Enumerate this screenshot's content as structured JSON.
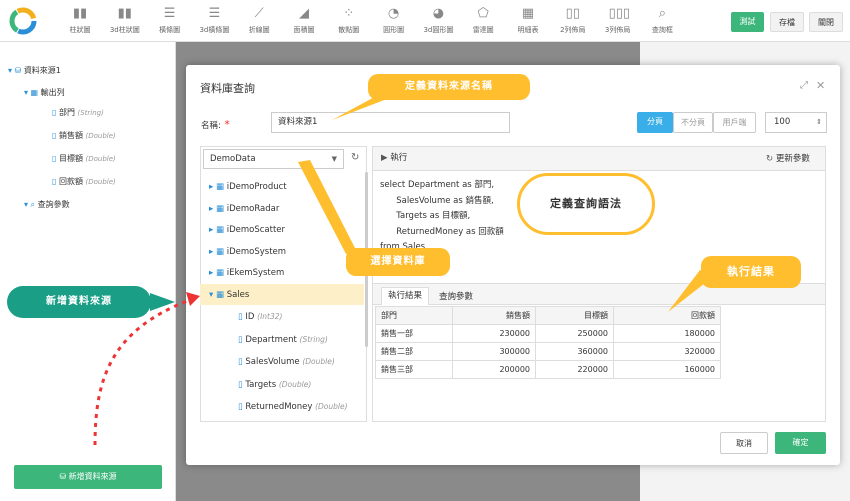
{
  "toolbar": {
    "tools": [
      {
        "label": "柱狀圖",
        "icon": "bar-chart-icon"
      },
      {
        "label": "3d柱狀圖",
        "icon": "3d-bar-chart-icon"
      },
      {
        "label": "橫條圖",
        "icon": "horizontal-bar-icon"
      },
      {
        "label": "3d橫條圖",
        "icon": "3d-horizontal-bar-icon"
      },
      {
        "label": "折線圖",
        "icon": "line-chart-icon"
      },
      {
        "label": "面積圖",
        "icon": "area-chart-icon"
      },
      {
        "label": "散點圖",
        "icon": "scatter-chart-icon"
      },
      {
        "label": "圓形圖",
        "icon": "pie-chart-icon"
      },
      {
        "label": "3d圓形圖",
        "icon": "3d-pie-chart-icon"
      },
      {
        "label": "雷達圖",
        "icon": "radar-chart-icon"
      },
      {
        "label": "明細表",
        "icon": "table-icon"
      },
      {
        "label": "2列佈局",
        "icon": "two-column-icon"
      },
      {
        "label": "3列佈局",
        "icon": "three-column-icon"
      },
      {
        "label": "查詢框",
        "icon": "search-icon"
      }
    ],
    "test_label": "測試",
    "save_label": "存檔",
    "close_label": "關閉",
    "accent": "#3cb67b"
  },
  "tree": {
    "datasource": "資料來源1",
    "output": "輸出列",
    "fields": [
      {
        "name": "部門",
        "type": "(String)"
      },
      {
        "name": "銷售額",
        "type": "(Double)"
      },
      {
        "name": "目標額",
        "type": "(Double)"
      },
      {
        "name": "回款額",
        "type": "(Double)"
      }
    ],
    "params": "查詢參數"
  },
  "add_datasource_button": "新增資料來源",
  "dialog": {
    "title": "資料庫查詢",
    "name_label": "名稱:",
    "name_value": "資料來源1",
    "paging": [
      "分頁",
      "不分頁",
      "用戶端"
    ],
    "page_size": "100",
    "database": "DemoData",
    "execute_label": "執行",
    "refresh_params_label": "更新參數",
    "tables": [
      {
        "name": "iDemoProduct"
      },
      {
        "name": "iDemoRadar"
      },
      {
        "name": "iDemoScatter"
      },
      {
        "name": "iDemoSystem"
      },
      {
        "name": "iEkemSystem"
      },
      {
        "name": "Sales"
      }
    ],
    "columns": [
      {
        "name": "ID",
        "type": "(Int32)"
      },
      {
        "name": "Department",
        "type": "(String)"
      },
      {
        "name": "SalesVolume",
        "type": "(Double)"
      },
      {
        "name": "Targets",
        "type": "(Double)"
      },
      {
        "name": "ReturnedMoney",
        "type": "(Double)"
      }
    ],
    "sql": "select Department as 部門,\n      SalesVolume as 銷售額,\n      Targets as 目標額,\n      ReturnedMoney as 回款額\nfrom Sales",
    "result_tabs": [
      "執行結果",
      "查詢參數"
    ],
    "result_headers": [
      "部門",
      "銷售額",
      "目標額",
      "回款額"
    ],
    "result_rows": [
      [
        "銷售一部",
        "230000",
        "250000",
        "180000"
      ],
      [
        "銷售二部",
        "300000",
        "360000",
        "320000"
      ],
      [
        "銷售三部",
        "200000",
        "220000",
        "160000"
      ]
    ],
    "cancel_label": "取消",
    "ok_label": "確定"
  },
  "callouts": {
    "define_name": "定義資料來源名稱",
    "define_sql": "定義查詢語法",
    "select_db": "選擇資料庫",
    "result": "執行結果",
    "add_new": "新增資料來源"
  },
  "colors": {
    "callout": "#ffbe2e",
    "teal": "#1a9e86",
    "primary": "#3aaee8",
    "green": "#3cb67b"
  }
}
